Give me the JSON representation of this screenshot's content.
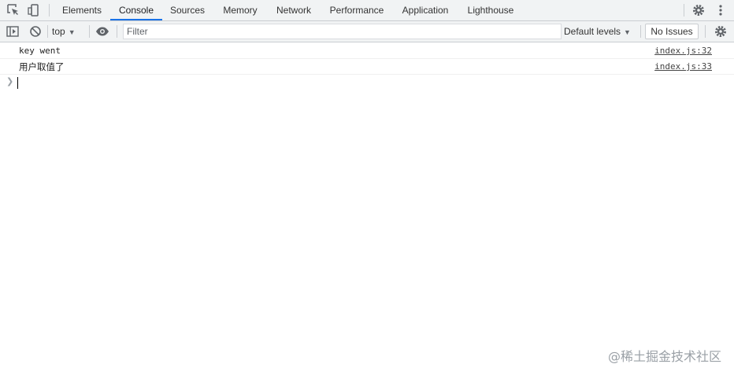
{
  "tabbar": {
    "tabs": [
      {
        "label": "Elements"
      },
      {
        "label": "Console"
      },
      {
        "label": "Sources"
      },
      {
        "label": "Memory"
      },
      {
        "label": "Network"
      },
      {
        "label": "Performance"
      },
      {
        "label": "Application"
      },
      {
        "label": "Lighthouse"
      }
    ],
    "active_tab": "Console",
    "icons": [
      "inspect-element-icon",
      "device-toolbar-icon",
      "settings-gear-icon",
      "more-options-icon"
    ]
  },
  "toolbar": {
    "context": "top",
    "filter_placeholder": "Filter",
    "filter_value": "",
    "levels_label": "Default levels",
    "issues_label": "No Issues",
    "icons": [
      "sidebar-toggle-icon",
      "clear-console-icon",
      "live-expression-eye-icon",
      "console-settings-icon"
    ]
  },
  "console": {
    "messages": [
      {
        "text": "key went",
        "source": "index.js:32"
      },
      {
        "text": "用户取值了",
        "source": "index.js:33"
      }
    ]
  },
  "watermark": "@稀土掘金技术社区",
  "colors": {
    "accent": "#1a73e8",
    "toolbar_bg": "#f1f3f4",
    "border": "#cacdd1"
  }
}
